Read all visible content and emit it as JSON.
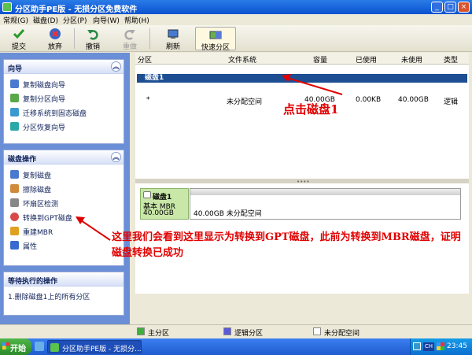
{
  "window": {
    "title": "分区助手PE版 - 无损分区免费软件"
  },
  "menu": [
    "常规(G)",
    "磁盘(D)",
    "分区(P)",
    "向导(W)",
    "帮助(H)"
  ],
  "toolbar": {
    "commit": "提交",
    "discard": "放弃",
    "undo": "撤销",
    "redo": "重做",
    "refresh": "刷新",
    "quick_partition": "快速分区"
  },
  "wizards": {
    "title": "向导",
    "items": [
      "复制磁盘向导",
      "复制分区向导",
      "迁移系统到固态磁盘",
      "分区恢复向导"
    ]
  },
  "disk_ops": {
    "title": "磁盘操作",
    "items": [
      "复制磁盘",
      "擦除磁盘",
      "坏扇区检测",
      "转换到GPT磁盘",
      "重建MBR",
      "属性"
    ]
  },
  "pending": {
    "title": "等待执行的操作",
    "items": [
      "1.删除磁盘1上的所有分区"
    ]
  },
  "table": {
    "headers": [
      "分区",
      "文件系统",
      "容量",
      "已使用",
      "未使用",
      "类型"
    ],
    "disk_label": "磁盘1",
    "row": {
      "partition": "*",
      "fs": "未分配空间",
      "capacity": "40.00GB",
      "used": "0.00KB",
      "unused": "40.00GB",
      "type": "逻辑"
    }
  },
  "diskmap": {
    "name": "磁盘1",
    "kind": "基本 MBR",
    "size": "40.00GB",
    "partition_text": "40.00GB 未分配空间"
  },
  "legend": [
    "主分区",
    "逻辑分区",
    "未分配空间"
  ],
  "taskbar": {
    "start": "开始",
    "task": "分区助手PE版 - 无损分...",
    "lang": "CH",
    "clock": "23:45"
  },
  "annotations": {
    "click_disk": "点击磁盘1",
    "explain": "这里我们会看到这里显示为转换到GPT磁盘，此前为转换到MBR磁盘，证明磁盘转换已成功"
  },
  "colors": {
    "primary": "#3fae3f",
    "logical": "#5a5ad8",
    "unallocated": "#ffffff",
    "disk_row": "#1c4e91",
    "annotation": "#e00000"
  }
}
